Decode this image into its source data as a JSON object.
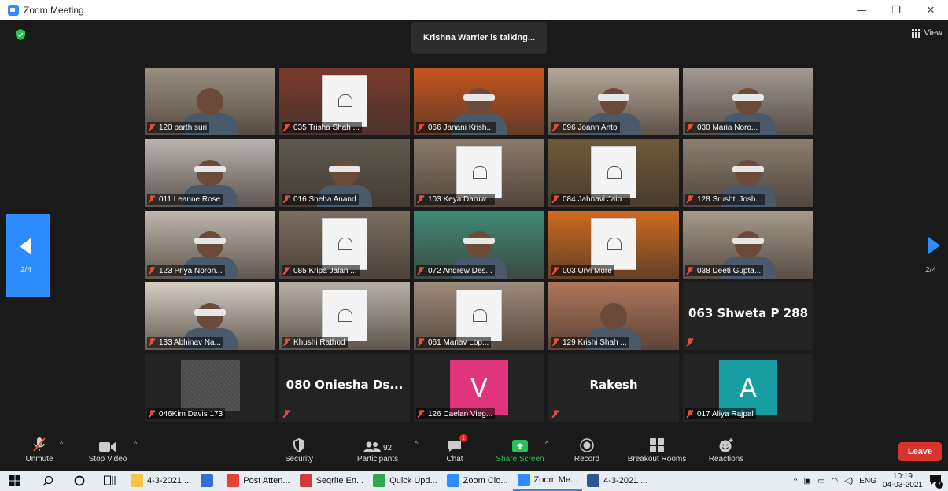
{
  "window": {
    "title": "Zoom Meeting",
    "min": "—",
    "max": "❐",
    "close": "✕"
  },
  "meeting": {
    "talking": "Krishna Warrier is talking...",
    "view_label": "View",
    "page_left": "2/4",
    "page_right": "2/4"
  },
  "participants": [
    {
      "name": "120 parth suri",
      "type": "video",
      "bg": "#9a9080",
      "kind": "person"
    },
    {
      "name": "035 Trisha Shah ...",
      "type": "video",
      "bg": "#7a3a2e",
      "kind": "paper"
    },
    {
      "name": "066 Janani Krish...",
      "type": "video",
      "bg": "#c8541e",
      "kind": "blind"
    },
    {
      "name": "096 Joann Anto",
      "type": "video",
      "bg": "#b7a999",
      "kind": "blind"
    },
    {
      "name": "030 Maria Noro...",
      "type": "video",
      "bg": "#a19a92",
      "kind": "blind"
    },
    {
      "name": "011 Leanne Rose",
      "type": "video",
      "bg": "#b9b3ae",
      "kind": "blind"
    },
    {
      "name": "016 Sneha Anand",
      "type": "video",
      "bg": "#5e5a4e",
      "kind": "blind"
    },
    {
      "name": "103 Keya Daruw...",
      "type": "video",
      "bg": "#8a7a6a",
      "kind": "paper"
    },
    {
      "name": "084 Jahnavi Jaip...",
      "type": "video",
      "bg": "#6e5a3a",
      "kind": "paper"
    },
    {
      "name": "128 Srushti Josh...",
      "type": "video",
      "bg": "#8a7e70",
      "kind": "blind"
    },
    {
      "name": "123 Priya Noron...",
      "type": "video",
      "bg": "#c0b8ae",
      "kind": "blind"
    },
    {
      "name": "085 Kripa Jalan ...",
      "type": "video",
      "bg": "#7a6e60",
      "kind": "paper"
    },
    {
      "name": "072 Andrew Des...",
      "type": "video",
      "bg": "#3f8a78",
      "kind": "blind"
    },
    {
      "name": "003 Urvi More",
      "type": "video",
      "bg": "#d06a20",
      "kind": "paper"
    },
    {
      "name": "038 Deeti Gupta...",
      "type": "video",
      "bg": "#a59a8a",
      "kind": "blind"
    },
    {
      "name": "133 Abhinav Na...",
      "type": "video",
      "bg": "#d4ccc2",
      "kind": "blind"
    },
    {
      "name": "Khushi Rathod",
      "type": "video",
      "bg": "#b8b0a6",
      "kind": "paper"
    },
    {
      "name": "061 Manav Lop...",
      "type": "video",
      "bg": "#9c8a7a",
      "kind": "paper"
    },
    {
      "name": "129 Krishi Shah ...",
      "type": "video",
      "bg": "#b0765a",
      "kind": "person"
    },
    {
      "name": "",
      "type": "name",
      "display": "063 Shweta P 288"
    },
    {
      "name": "046Kim Davis 173",
      "type": "noise"
    },
    {
      "name": "",
      "type": "name",
      "display": "080 Oniesha Ds..."
    },
    {
      "name": "126 Caelan Vieg...",
      "type": "letter",
      "letter": "V",
      "color": "#e0357a"
    },
    {
      "name": "",
      "type": "name",
      "display": "Rakesh"
    },
    {
      "name": "017 Aliya Rajpal",
      "type": "letter",
      "letter": "A",
      "color": "#179ea3"
    }
  ],
  "toolbar": {
    "unmute": "Unmute",
    "stop_video": "Stop Video",
    "security": "Security",
    "participants": "Participants",
    "participants_count": "92",
    "chat": "Chat",
    "chat_badge": "1",
    "share_screen": "Share Screen",
    "record": "Record",
    "breakout_rooms": "Breakout Rooms",
    "reactions": "Reactions",
    "leave": "Leave",
    "share_color": "#24c05a",
    "leave_color": "#d9342b"
  },
  "taskbar": {
    "items": [
      {
        "label": "4-3-2021 ...",
        "icon_color": "#f4c542"
      },
      {
        "label": "",
        "icon_color": "#2f6fd6"
      },
      {
        "label": "Post Atten...",
        "icon_color": "#e94235"
      },
      {
        "label": "Seqrite En...",
        "icon_color": "#d23b3b"
      },
      {
        "label": "Quick Upd...",
        "icon_color": "#2fa84f"
      },
      {
        "label": "Zoom Clo...",
        "icon_color": "#2d8cff"
      },
      {
        "label": "Zoom Me...",
        "icon_color": "#2d8cff"
      },
      {
        "label": "4-3-2021 ...",
        "icon_color": "#2b579a"
      }
    ],
    "lang": "ENG",
    "time": "10:19",
    "date": "04-03-2021",
    "notif_count": "7"
  }
}
